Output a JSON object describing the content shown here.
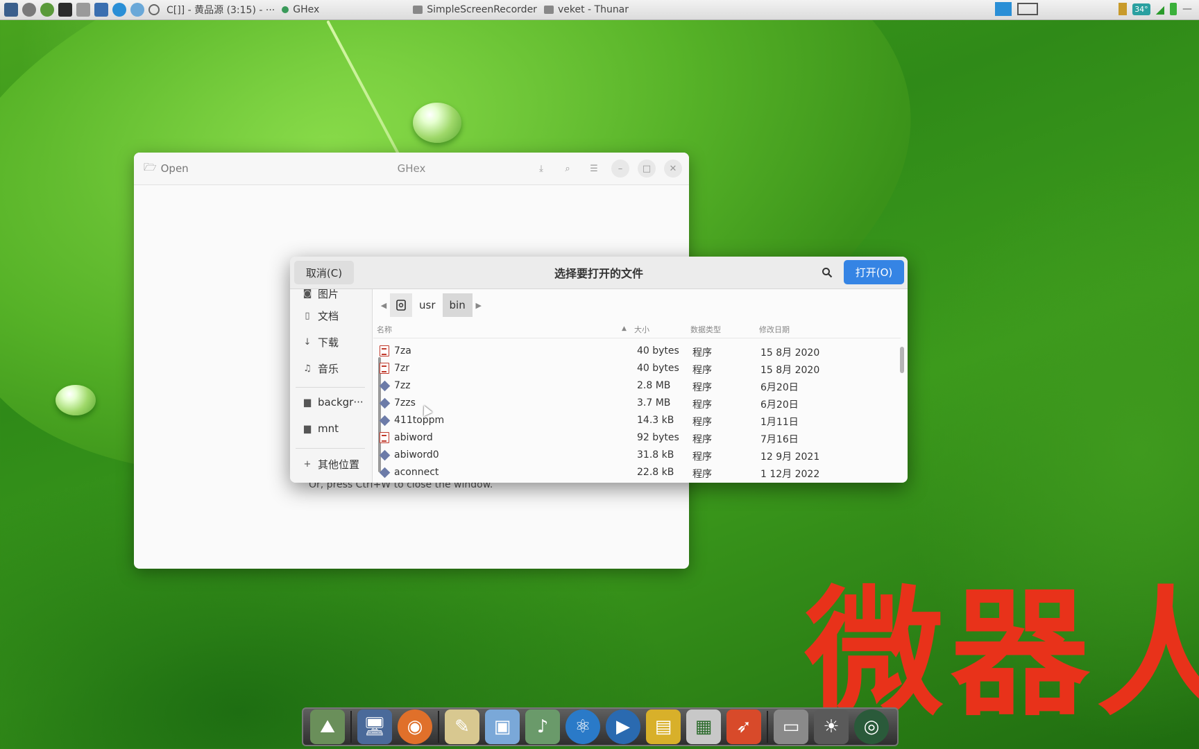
{
  "top_panel": {
    "tasks": [
      {
        "label": "C[]] - 黄品源 (3:15) - ···"
      },
      {
        "label": "GHex"
      },
      {
        "label": "SimpleScreenRecorder"
      },
      {
        "label": "veket - Thunar"
      }
    ],
    "temperature": "34°"
  },
  "ghex": {
    "open_label": "Open",
    "title": "GHex",
    "hint": "Or, press Ctrl+W to close the window."
  },
  "dialog": {
    "cancel_label": "取消(C)",
    "title": "选择要打开的文件",
    "open_label": "打开(O)",
    "sidebar": {
      "items": [
        {
          "label": "图片",
          "icon": "camera-icon"
        },
        {
          "label": "文档",
          "icon": "document-icon"
        },
        {
          "label": "下载",
          "icon": "download-icon"
        },
        {
          "label": "音乐",
          "icon": "music-icon"
        },
        {
          "label": "backgr···",
          "icon": "folder-icon"
        },
        {
          "label": "mnt",
          "icon": "folder-icon"
        },
        {
          "label": "其他位置",
          "icon": "plus-icon"
        }
      ]
    },
    "path": [
      "usr",
      "bin"
    ],
    "columns": {
      "name": "名称",
      "size": "大小",
      "type": "数据类型",
      "modified": "修改日期"
    },
    "files": [
      {
        "name": "7za",
        "size": "40 bytes",
        "type": "程序",
        "modified": "15 8月 2020",
        "kind": "text"
      },
      {
        "name": "7zr",
        "size": "40 bytes",
        "type": "程序",
        "modified": "15 8月 2020",
        "kind": "text"
      },
      {
        "name": "7zz",
        "size": "2.8 MB",
        "type": "程序",
        "modified": "6月20日",
        "kind": "exe"
      },
      {
        "name": "7zzs",
        "size": "3.7 MB",
        "type": "程序",
        "modified": "6月20日",
        "kind": "exe"
      },
      {
        "name": "411toppm",
        "size": "14.3 kB",
        "type": "程序",
        "modified": "1月11日",
        "kind": "exe"
      },
      {
        "name": "abiword",
        "size": "92 bytes",
        "type": "程序",
        "modified": "7月16日",
        "kind": "text"
      },
      {
        "name": "abiword0",
        "size": "31.8 kB",
        "type": "程序",
        "modified": "12 9月 2021",
        "kind": "exe"
      },
      {
        "name": "aconnect",
        "size": "22.8 kB",
        "type": "程序",
        "modified": "1 12月 2022",
        "kind": "exe"
      }
    ]
  },
  "watermark": "微器人",
  "colors": {
    "accent": "#3584e4",
    "watermark": "#e8321a"
  }
}
